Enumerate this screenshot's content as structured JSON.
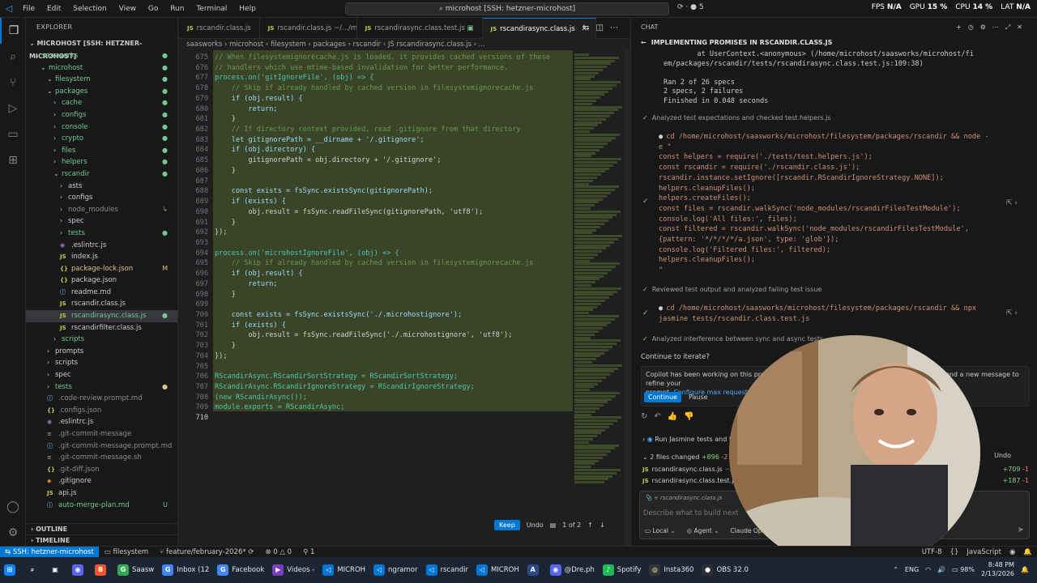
{
  "titlebar": {
    "menu": [
      "File",
      "Edit",
      "Selection",
      "View",
      "Go",
      "Run",
      "Terminal",
      "Help"
    ],
    "search": "microhost [SSH: hetzner-microhost]",
    "copilot_count": "5",
    "fps_label": "FPS",
    "fps_val": "N/A",
    "gpu_label": "GPU",
    "gpu_val": "15 %",
    "cpu_label": "CPU",
    "cpu_val": "14 %",
    "lat_label": "LAT",
    "lat_val": "N/A"
  },
  "explorer": {
    "header": "EXPLORER",
    "root": "MICROHOST [SSH: HETZNER-MICROHOST]",
    "items": [
      {
        "label": "saasworks",
        "indent": 1,
        "type": "folder-open",
        "cls": "folder-green",
        "badge": "●",
        "badgeColor": "#73c991"
      },
      {
        "label": "microhost",
        "indent": 2,
        "type": "folder-open",
        "cls": "folder-green",
        "badge": "●",
        "badgeColor": "#73c991"
      },
      {
        "label": "filesystem",
        "indent": 3,
        "type": "folder-open",
        "cls": "folder-green",
        "badge": "●",
        "badgeColor": "#73c991"
      },
      {
        "label": "packages",
        "indent": 3,
        "type": "folder-open",
        "cls": "folder-green",
        "badge": "●",
        "badgeColor": "#73c991"
      },
      {
        "label": "cache",
        "indent": 4,
        "type": "folder",
        "cls": "folder-green",
        "badge": "●",
        "badgeColor": "#73c991"
      },
      {
        "label": "configs",
        "indent": 4,
        "type": "folder",
        "cls": "folder-green",
        "badge": "●",
        "badgeColor": "#73c991"
      },
      {
        "label": "console",
        "indent": 4,
        "type": "folder",
        "cls": "folder-green",
        "badge": "●",
        "badgeColor": "#73c991"
      },
      {
        "label": "crypto",
        "indent": 4,
        "type": "folder",
        "cls": "folder-green",
        "badge": "●",
        "badgeColor": "#73c991"
      },
      {
        "label": "files",
        "indent": 4,
        "type": "folder",
        "cls": "folder-green",
        "badge": "●",
        "badgeColor": "#73c991"
      },
      {
        "label": "helpers",
        "indent": 4,
        "type": "folder",
        "cls": "folder-green",
        "badge": "●",
        "badgeColor": "#73c991"
      },
      {
        "label": "rscandir",
        "indent": 4,
        "type": "folder-open",
        "cls": "folder-green",
        "badge": "●",
        "badgeColor": "#73c991"
      },
      {
        "label": "asts",
        "indent": 5,
        "type": "folder",
        "cls": "",
        "badge": "",
        "badgeColor": ""
      },
      {
        "label": "configs",
        "indent": 5,
        "type": "folder",
        "cls": "",
        "badge": "",
        "badgeColor": ""
      },
      {
        "label": "node_modules",
        "indent": 5,
        "type": "folder",
        "cls": "ign",
        "badge": "↳",
        "badgeColor": "#8c8c8c"
      },
      {
        "label": "spec",
        "indent": 5,
        "type": "folder",
        "cls": "",
        "badge": "",
        "badgeColor": ""
      },
      {
        "label": "tests",
        "indent": 5,
        "type": "folder",
        "cls": "folder-green",
        "badge": "●",
        "badgeColor": "#73c991"
      },
      {
        "label": ".eslintrc.js",
        "indent": 5,
        "type": "eslint",
        "cls": "",
        "badge": "",
        "badgeColor": ""
      },
      {
        "label": "index.js",
        "indent": 5,
        "type": "js",
        "cls": "",
        "badge": "",
        "badgeColor": ""
      },
      {
        "label": "package-lock.json",
        "indent": 5,
        "type": "json",
        "cls": "mod",
        "badge": "M",
        "badgeColor": "#e2c08d"
      },
      {
        "label": "package.json",
        "indent": 5,
        "type": "json",
        "cls": "",
        "badge": "",
        "badgeColor": ""
      },
      {
        "label": "readme.md",
        "indent": 5,
        "type": "md",
        "cls": "",
        "badge": "",
        "badgeColor": ""
      },
      {
        "label": "rscandir.class.js",
        "indent": 5,
        "type": "js",
        "cls": "",
        "badge": "",
        "badgeColor": ""
      },
      {
        "label": "rscandirasync.class.js",
        "indent": 5,
        "type": "js",
        "cls": "add",
        "badge": "●",
        "badgeColor": "#73c991",
        "selected": true
      },
      {
        "label": "rscandirfilter.class.js",
        "indent": 5,
        "type": "js",
        "cls": "",
        "badge": "",
        "badgeColor": ""
      },
      {
        "label": "scripts",
        "indent": 4,
        "type": "folder",
        "cls": "folder-green",
        "badge": "",
        "badgeColor": ""
      },
      {
        "label": "prompts",
        "indent": 3,
        "type": "folder",
        "cls": "",
        "badge": "",
        "badgeColor": ""
      },
      {
        "label": "scripts",
        "indent": 3,
        "type": "folder",
        "cls": "",
        "badge": "",
        "badgeColor": ""
      },
      {
        "label": "spec",
        "indent": 3,
        "type": "folder",
        "cls": "",
        "badge": "",
        "badgeColor": ""
      },
      {
        "label": "tests",
        "indent": 3,
        "type": "folder",
        "cls": "folder-green",
        "badge": "●",
        "badgeColor": "#e2c08d"
      },
      {
        "label": ".code-review.prompt.md",
        "indent": 3,
        "type": "md",
        "cls": "ign",
        "badge": "",
        "badgeColor": ""
      },
      {
        "label": ".configs.json",
        "indent": 3,
        "type": "json",
        "cls": "ign",
        "badge": "",
        "badgeColor": ""
      },
      {
        "label": ".eslintrc.js",
        "indent": 3,
        "type": "eslint",
        "cls": "",
        "badge": "",
        "badgeColor": ""
      },
      {
        "label": ".git-commit-message",
        "indent": 3,
        "type": "file",
        "cls": "ign",
        "badge": "",
        "badgeColor": ""
      },
      {
        "label": ".git-commit-message.prompt.md",
        "indent": 3,
        "type": "md",
        "cls": "ign",
        "badge": "",
        "badgeColor": ""
      },
      {
        "label": ".git-commit-message.sh",
        "indent": 3,
        "type": "file",
        "cls": "ign",
        "badge": "",
        "badgeColor": ""
      },
      {
        "label": ".git-diff.json",
        "indent": 3,
        "type": "json",
        "cls": "ign",
        "badge": "",
        "badgeColor": ""
      },
      {
        "label": ".gitignore",
        "indent": 3,
        "type": "git",
        "cls": "",
        "badge": "",
        "badgeColor": ""
      },
      {
        "label": "api.js",
        "indent": 3,
        "type": "js",
        "cls": "",
        "badge": "",
        "badgeColor": ""
      },
      {
        "label": "auto-merge-plan.md",
        "indent": 3,
        "type": "md",
        "cls": "folder-green",
        "badge": "U",
        "badgeColor": "#73c991"
      }
    ],
    "outline": "OUTLINE",
    "timeline": "TIMELINE"
  },
  "editor": {
    "tabs": [
      {
        "label": "rscandir.class.js",
        "active": false
      },
      {
        "label": "rscandir.class.js ~/.../microhost/filesystem/...",
        "active": false
      },
      {
        "label": "rscandirasync.class.test.js",
        "active": false
      },
      {
        "label": "rscandirasync.class.js",
        "active": true
      }
    ],
    "breadcrumb": "saasworks › microhost › filesystem › packages › rscandir › JS rscandirasync.class.js › ...",
    "lines": [
      {
        "n": "675",
        "t": "// When filesystemignorecache.js is loaded, it provides cached versions of these"
      },
      {
        "n": "676",
        "t": "// handlers which use mtime-based invalidation for better performance."
      },
      {
        "n": "677",
        "t": "process.on('gitIgnoreFile', (obj) => {"
      },
      {
        "n": "678",
        "t": "    // Skip if already handled by cached version in filesystemignorecache.js"
      },
      {
        "n": "679",
        "t": "    if (obj.result) {"
      },
      {
        "n": "680",
        "t": "        return;"
      },
      {
        "n": "681",
        "t": "    }"
      },
      {
        "n": "682",
        "t": "    // If directory context provided, read .gitignore from that directory"
      },
      {
        "n": "683",
        "t": "    let gitignorePath = __dirname + '/.gitignore';"
      },
      {
        "n": "684",
        "t": "    if (obj.directory) {"
      },
      {
        "n": "685",
        "t": "        gitignorePath = obj.directory + '/.gitignore';"
      },
      {
        "n": "686",
        "t": "    }"
      },
      {
        "n": "687",
        "t": ""
      },
      {
        "n": "688",
        "t": "    const exists = fsSync.existsSync(gitignorePath);"
      },
      {
        "n": "689",
        "t": "    if (exists) {"
      },
      {
        "n": "690",
        "t": "        obj.result = fsSync.readFileSync(gitignorePath, 'utf8');"
      },
      {
        "n": "691",
        "t": "    }"
      },
      {
        "n": "692",
        "t": "});"
      },
      {
        "n": "693",
        "t": ""
      },
      {
        "n": "694",
        "t": "process.on('microhostIgnoreFile', (obj) => {"
      },
      {
        "n": "695",
        "t": "    // Skip if already handled by cached version in filesystemignorecache.js"
      },
      {
        "n": "696",
        "t": "    if (obj.result) {"
      },
      {
        "n": "697",
        "t": "        return;"
      },
      {
        "n": "698",
        "t": "    }"
      },
      {
        "n": "699",
        "t": ""
      },
      {
        "n": "700",
        "t": "    const exists = fsSync.existsSync('./.microhostignore');"
      },
      {
        "n": "701",
        "t": "    if (exists) {"
      },
      {
        "n": "702",
        "t": "        obj.result = fsSync.readFileSync('./.microhostignore', 'utf8');"
      },
      {
        "n": "703",
        "t": "    }"
      },
      {
        "n": "704",
        "t": "});"
      },
      {
        "n": "705",
        "t": ""
      },
      {
        "n": "706",
        "t": "RScandirAsync.RScandirSortStrategy = RScandirSortStrategy;"
      },
      {
        "n": "707",
        "t": "RScandirAsync.RScandirIgnoreStrategy = RScandirIgnoreStrategy;"
      },
      {
        "n": "708",
        "t": "(new RScandirAsync());"
      },
      {
        "n": "709",
        "t": "module.exports = RScandirAsync;"
      },
      {
        "n": "710",
        "t": ""
      }
    ],
    "keep": "Keep",
    "undo": "Undo",
    "page": "1 of 2"
  },
  "chat": {
    "header": "CHAT",
    "title": "IMPLEMENTING PROMISES IN RSCANDIR.CLASS.JS",
    "stack": "        at UserContext.<anonymous> (/home/microhost/saasworks/microhost/fi\nem/packages/rscandir/tests/rscandirasync.class.test.js:109:38)\n\nRan 2 of 26 specs\n2 specs, 2 failures\nFinished in 0.048 seconds",
    "step1": "Analyzed test expectations and checked test.helpers.js",
    "cmd1": "cd /home/microhost/saasworks/microhost/filesystem/packages/rscandir && node -\ne \"\nconst helpers = require('./tests/test.helpers.js');\nconst rscandir = require('./rscandir.class.js');\nrscandir.instance.setIgnore([rscandir.RScandirIgnoreStrategy.NONE]);\nhelpers.cleanupFiles();\nhelpers.createFiles();\nconst files = rscandir.walkSync('node_modules/rscandirFilesTestModule');\nconsole.log('All files:', files);\nconst filtered = rscandir.walkSync('node_modules/rscandirFilesTestModule',\n{pattern: '*/*/*/*/a.json', type: 'glob'});\nconsole.log('Filtered files:', filtered);\nhelpers.cleanupFiles();\n\"",
    "step2": "Reviewed test output and analyzed failing test issue",
    "cmd2": "cd /home/microhost/saasworks/microhost/filesystem/packages/rscandir && npx\njasmine tests/rscandir.class.test.js",
    "step3": "Analyzed interference between sync and async tests",
    "iterate_q": "Continue to iterate?",
    "iterate_text": "Copilot has been working on this problem for a while. It can continue to iterate, or you can send a new message to refine your",
    "iterate_text2": "prompt.",
    "iterate_link": "Configure max requests.",
    "continue": "Continue",
    "pause": "Pause",
    "run_task": "Run Jasmine tests and fix...",
    "files_changed": "2 files changed",
    "files_plus": "+896",
    "files_minus": "-2",
    "undo": "Undo",
    "files": [
      {
        "name": "rscandirasync.class.js",
        "path": "~/sa...",
        "plus": "+709",
        "minus": "-1"
      },
      {
        "name": "rscandirasync.class.test.js",
        "path": "",
        "plus": "+187",
        "minus": "-1"
      }
    ],
    "attach": "rscandirasync.class.js",
    "placeholder": "Describe what to build next",
    "opt_local": "Local",
    "opt_agent": "Agent",
    "opt_model": "Claude Opus..."
  },
  "status": {
    "remote": "SSH: hetzner-microhost",
    "folder": "filesystem",
    "branch": "feature/february-2026*",
    "errors": "0",
    "warnings": "0",
    "ports": "1",
    "enc": "UTF-8",
    "lang": "JavaScript"
  },
  "taskbar": {
    "apps": [
      {
        "label": "",
        "icon": "⊞",
        "color": "#0a84ff"
      },
      {
        "label": "",
        "icon": "⌕",
        "color": "transparent"
      },
      {
        "label": "",
        "icon": "▣",
        "color": "transparent"
      },
      {
        "label": "",
        "icon": "◉",
        "color": "#5865f2"
      },
      {
        "label": "",
        "icon": "B",
        "color": "#fb542b"
      },
      {
        "label": "Saasw",
        "icon": "G",
        "color": "#34a853"
      },
      {
        "label": "Inbox (12",
        "icon": "G",
        "color": "#4285f4"
      },
      {
        "label": "Facebook",
        "icon": "G",
        "color": "#4285f4"
      },
      {
        "label": "Videos -",
        "icon": "▶",
        "color": "#7a3fbf"
      },
      {
        "label": "MICROH",
        "icon": "◁",
        "color": "#0078d4"
      },
      {
        "label": "ngramor",
        "icon": "◁",
        "color": "#0078d4"
      },
      {
        "label": "rscandir",
        "icon": "◁",
        "color": "#0078d4"
      },
      {
        "label": "MICROH",
        "icon": "◁",
        "color": "#0078d4"
      },
      {
        "label": "",
        "icon": "A",
        "color": "#2a4a8a"
      },
      {
        "label": "@Dre.ph",
        "icon": "◉",
        "color": "#5865f2"
      },
      {
        "label": "Spotify",
        "icon": "♪",
        "color": "#1db954"
      },
      {
        "label": "Insta360",
        "icon": "◎",
        "color": "#333333"
      },
      {
        "label": "OBS 32.0",
        "icon": "●",
        "color": "#302e31"
      }
    ],
    "lang": "ENG",
    "battery": "98%",
    "time": "8:48 PM",
    "date": "2/13/2026"
  }
}
